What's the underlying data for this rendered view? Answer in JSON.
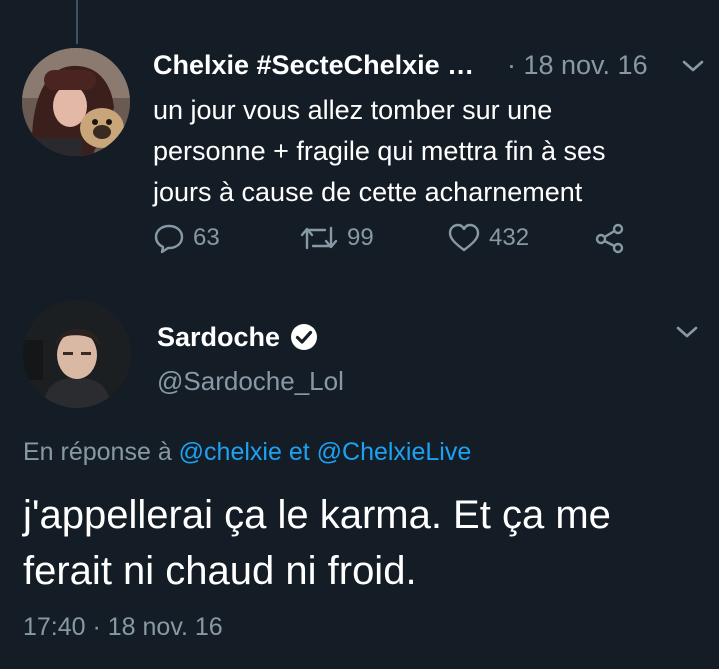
{
  "colors": {
    "background": "#141d26",
    "primary_text": "#ffffff",
    "secondary_text": "#8899a6",
    "link": "#1da1f2",
    "thread_line": "#3d5466"
  },
  "tweet1": {
    "author_name": "Chelxie #SecteChelxie …",
    "date": "· 18 nov. 16",
    "text_lines": [
      "un jour vous allez tomber sur une",
      "personne + fragile qui mettra fin à ses",
      "jours à cause de cette acharnement"
    ],
    "stats": {
      "replies": "63",
      "retweets": "99",
      "likes": "432"
    },
    "icons": [
      "reply-icon",
      "retweet-icon",
      "like-icon",
      "share-icon",
      "chevron-down-icon"
    ]
  },
  "tweet2": {
    "author_name": "Sardoche",
    "handle": "@Sardoche_Lol",
    "reply_prefix": "En réponse à",
    "reply_mention_1": "@chelxie",
    "reply_conjunction": "et",
    "reply_mention_2": "@ChelxieLive",
    "text_lines": [
      "j'appellerai ça le karma. Et ça me",
      "ferait ni chaud ni froid."
    ],
    "timestamp": "17:40 · 18 nov. 16",
    "icons": [
      "verified-badge-icon",
      "chevron-down-icon"
    ]
  }
}
